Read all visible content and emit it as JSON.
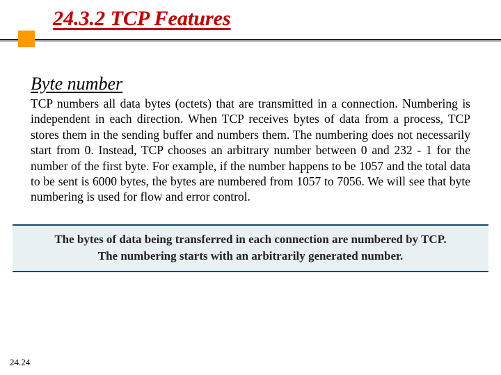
{
  "header": {
    "title": "24.3.2  TCP Features"
  },
  "section": {
    "subheading": "Byte number",
    "paragraph": "TCP numbers all data bytes (octets) that are transmitted in a connection. Numbering is independent in each direction. When TCP receives bytes of data from a process, TCP stores them in the sending buffer and numbers them. The numbering does not necessarily start from 0. Instead, TCP chooses an arbitrary number between 0 and 232 - 1 for the number of the first byte. For example, if the number happens to be 1057 and the total data to be sent is 6000 bytes, the bytes are numbered from 1057 to 7056. We will see that byte numbering is used for flow and error control."
  },
  "callout": {
    "line1": "The bytes of data being transferred in each connection are numbered by TCP.",
    "line2": "The numbering starts with an arbitrarily generated number."
  },
  "footer": {
    "page": "24.24"
  }
}
